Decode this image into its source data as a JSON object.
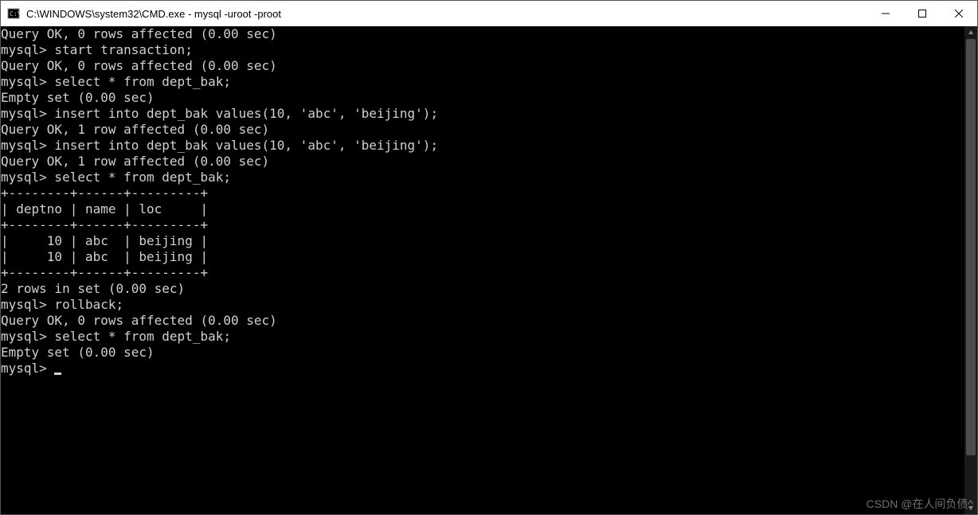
{
  "window": {
    "title": "C:\\WINDOWS\\system32\\CMD.exe - mysql  -uroot -proot"
  },
  "lines": [
    "Query OK, 0 rows affected (0.00 sec)",
    "",
    "mysql> start transaction;",
    "Query OK, 0 rows affected (0.00 sec)",
    "",
    "mysql> select * from dept_bak;",
    "Empty set (0.00 sec)",
    "",
    "mysql> insert into dept_bak values(10, 'abc', 'beijing');",
    "Query OK, 1 row affected (0.00 sec)",
    "",
    "mysql> insert into dept_bak values(10, 'abc', 'beijing');",
    "Query OK, 1 row affected (0.00 sec)",
    "",
    "mysql> select * from dept_bak;",
    "+--------+------+---------+",
    "| deptno | name | loc     |",
    "+--------+------+---------+",
    "|     10 | abc  | beijing |",
    "|     10 | abc  | beijing |",
    "+--------+------+---------+",
    "2 rows in set (0.00 sec)",
    "",
    "mysql> rollback;",
    "Query OK, 0 rows affected (0.00 sec)",
    "",
    "mysql> select * from dept_bak;",
    "Empty set (0.00 sec)",
    "",
    "mysql> "
  ],
  "watermark": "CSDN @在人间负债^"
}
